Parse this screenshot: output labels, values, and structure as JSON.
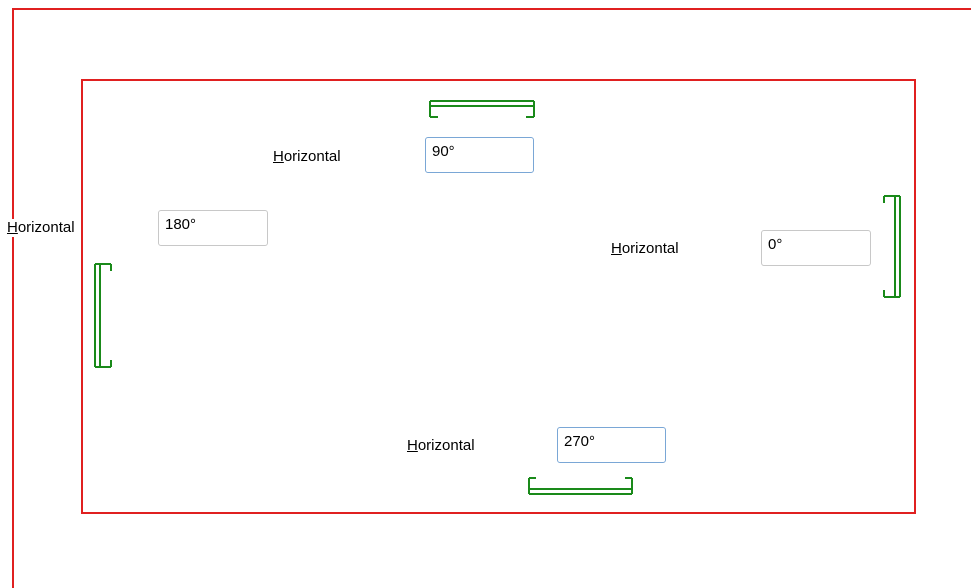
{
  "colors": {
    "border": "#e02020",
    "bracket": "#1a8a1a",
    "field_border": "#c8c8c8",
    "field_focus_border": "#7aa7d6"
  },
  "controls": {
    "top": {
      "label": "Horizontal",
      "mnemonic": "H",
      "label_rest": "orizontal",
      "value": "90°"
    },
    "left": {
      "label": "Horizontal",
      "mnemonic": "H",
      "label_rest": "orizontal",
      "value": "180°"
    },
    "right": {
      "label": "Horizontal",
      "mnemonic": "H",
      "label_rest": "orizontal",
      "value": "0°"
    },
    "bottom": {
      "label": "Horizontal",
      "mnemonic": "H",
      "label_rest": "orizontal",
      "value": "270°"
    }
  },
  "icons": {
    "top": "bracket-icon",
    "left": "bracket-icon",
    "right": "bracket-icon",
    "bottom": "bracket-icon"
  }
}
